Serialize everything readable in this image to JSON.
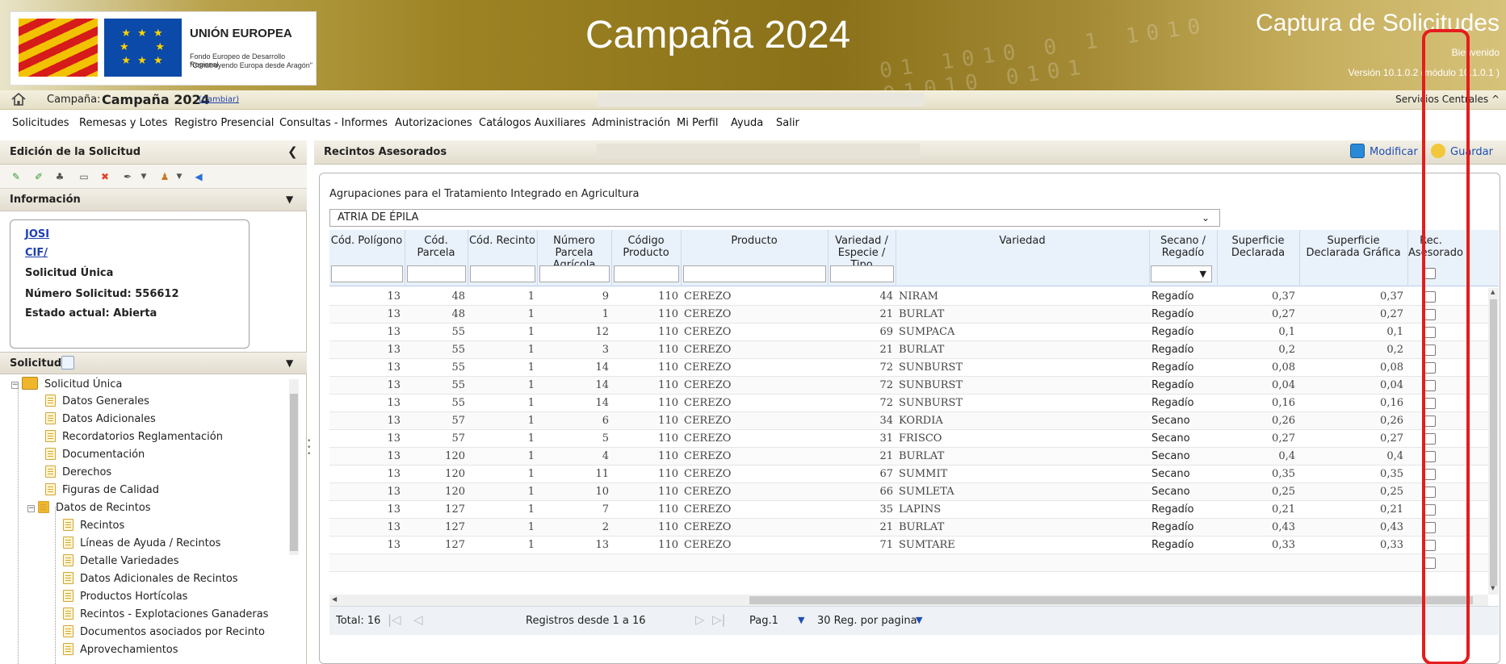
{
  "banner": {
    "eu_title": "UNIÓN EUROPEA",
    "eu_sub1": "Fondo Europeo de Desarrollo Regional",
    "eu_sub2": "\"Construyendo Europa desde Aragón\"",
    "campaign_title": "Campaña 2024",
    "app_title": "Captura de Solicitudes",
    "welcome": "Bienvenido",
    "version": "Versión 10.1.0.2 (módulo 10.1.0.1 )"
  },
  "campaign_bar": {
    "label": "Campaña:",
    "value": "Campaña 2024",
    "change_link": "(Cambiar)",
    "right_text": "Servicios Centrales ^"
  },
  "menu": [
    "Solicitudes",
    "Remesas y Lotes",
    "Registro Presencial",
    "Consultas - Informes",
    "Autorizaciones",
    "Catálogos Auxiliares",
    "Administración",
    "Mi Perfil",
    "Ayuda",
    "Salir"
  ],
  "left_panel": {
    "title": "Edición de la Solicitud",
    "info_title": "Información",
    "info": {
      "user": "JOSI",
      "cif": "CIF/",
      "type": "Solicitud Única",
      "number": "Número Solicitud: 556612",
      "state": "Estado actual: Abierta"
    },
    "solicitud_title": "Solicitud",
    "tree": [
      "Solicitud Única",
      "Datos Generales",
      "Datos Adicionales",
      "Recordatorios Reglamentación",
      "Documentación",
      "Derechos",
      "Figuras de Calidad",
      "Datos de Recintos",
      "Recintos",
      "Líneas de Ayuda / Recintos",
      "Detalle Variedades",
      "Datos Adicionales de Recintos",
      "Productos Hortícolas",
      "Recintos - Explotaciones Ganaderas",
      "Documentos asociados por Recinto",
      "Aprovechamientos"
    ]
  },
  "right_panel": {
    "title": "Recintos Asesorados",
    "modify_label": "Modificar",
    "save_label": "Guardar",
    "agrupacion_label": "Agrupaciones para el Tratamiento Integrado en Agricultura",
    "agrupacion_value": "ATRIA DE ÉPILA",
    "columns": {
      "poligono": "Cód. Polígono",
      "parcela": "Cód. Parcela",
      "recinto": "Cód. Recinto",
      "num_parcela": "Número Parcela Agrícola",
      "cod_producto": "Código Producto",
      "producto": "Producto",
      "variedad_tipo": "Variedad / Especie / Tipo",
      "variedad": "Variedad",
      "secano": "Secano / Regadío",
      "sup_decl": "Superficie Declarada",
      "sup_graf": "Superficie Declarada Gráfica",
      "rec_ases": "Rec. Asesorado"
    },
    "rows": [
      [
        "13",
        "48",
        "1",
        "9",
        "110",
        "CEREZO",
        "44",
        "NIRAM",
        "Regadío",
        "0,37",
        "0,37"
      ],
      [
        "13",
        "48",
        "1",
        "1",
        "110",
        "CEREZO",
        "21",
        "BURLAT",
        "Regadío",
        "0,27",
        "0,27"
      ],
      [
        "13",
        "55",
        "1",
        "12",
        "110",
        "CEREZO",
        "69",
        "SUMPACA",
        "Regadío",
        "0,1",
        "0,1"
      ],
      [
        "13",
        "55",
        "1",
        "3",
        "110",
        "CEREZO",
        "21",
        "BURLAT",
        "Regadío",
        "0,2",
        "0,2"
      ],
      [
        "13",
        "55",
        "1",
        "14",
        "110",
        "CEREZO",
        "72",
        "SUNBURST",
        "Regadío",
        "0,08",
        "0,08"
      ],
      [
        "13",
        "55",
        "1",
        "14",
        "110",
        "CEREZO",
        "72",
        "SUNBURST",
        "Regadío",
        "0,04",
        "0,04"
      ],
      [
        "13",
        "55",
        "1",
        "14",
        "110",
        "CEREZO",
        "72",
        "SUNBURST",
        "Regadío",
        "0,16",
        "0,16"
      ],
      [
        "13",
        "57",
        "1",
        "6",
        "110",
        "CEREZO",
        "34",
        "KORDIA",
        "Secano",
        "0,26",
        "0,26"
      ],
      [
        "13",
        "57",
        "1",
        "5",
        "110",
        "CEREZO",
        "31",
        "FRISCO",
        "Secano",
        "0,27",
        "0,27"
      ],
      [
        "13",
        "120",
        "1",
        "4",
        "110",
        "CEREZO",
        "21",
        "BURLAT",
        "Secano",
        "0,4",
        "0,4"
      ],
      [
        "13",
        "120",
        "1",
        "11",
        "110",
        "CEREZO",
        "67",
        "SUMMIT",
        "Secano",
        "0,35",
        "0,35"
      ],
      [
        "13",
        "120",
        "1",
        "10",
        "110",
        "CEREZO",
        "66",
        "SUMLETA",
        "Secano",
        "0,25",
        "0,25"
      ],
      [
        "13",
        "127",
        "1",
        "7",
        "110",
        "CEREZO",
        "35",
        "LAPINS",
        "Regadío",
        "0,21",
        "0,21"
      ],
      [
        "13",
        "127",
        "1",
        "2",
        "110",
        "CEREZO",
        "21",
        "BURLAT",
        "Regadío",
        "0,43",
        "0,43"
      ],
      [
        "13",
        "127",
        "1",
        "13",
        "110",
        "CEREZO",
        "71",
        "SUMTARE",
        "Regadío",
        "0,33",
        "0,33"
      ]
    ],
    "pager": {
      "total": "Total: 16",
      "range": "Registros desde 1 a 16",
      "page": "Pag.1",
      "per_page": "30 Reg. por pagina"
    }
  }
}
